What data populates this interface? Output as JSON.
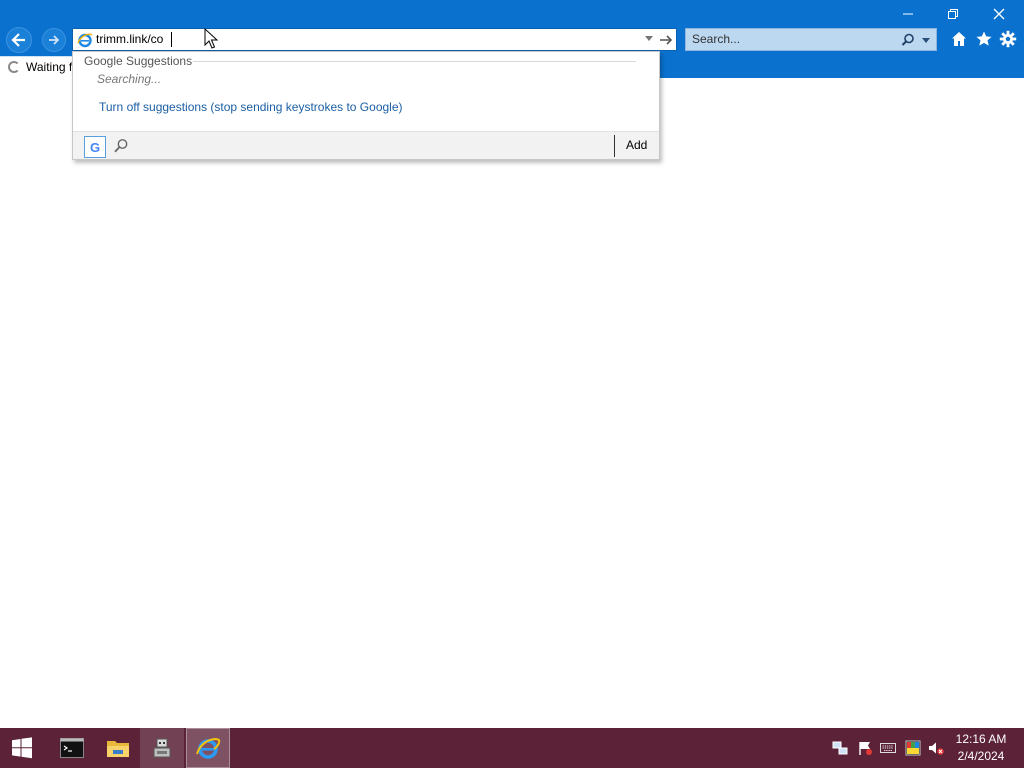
{
  "window": {
    "minimize_icon": "minimize-icon",
    "restore_icon": "restore-icon",
    "close_icon": "close-icon"
  },
  "address_bar": {
    "value": "trimm.link/co",
    "site_icon": "internet-explorer-icon"
  },
  "search_box": {
    "placeholder": "Search..."
  },
  "tab": {
    "title": "Waiting for"
  },
  "suggestions": {
    "heading": "Google Suggestions",
    "status": "Searching...",
    "turn_off_link": "Turn off suggestions (stop sending keystrokes to Google)",
    "provider_letter": "G",
    "add_label": "Add"
  },
  "taskbar": {
    "apps": [
      "start",
      "command-prompt",
      "file-explorer",
      "robot-app",
      "internet-explorer"
    ],
    "time": "12:16 AM",
    "date": "2/4/2024"
  },
  "colors": {
    "chrome_blue": "#0a72ce",
    "taskbar": "#5b2238",
    "link": "#1c5fa3"
  }
}
